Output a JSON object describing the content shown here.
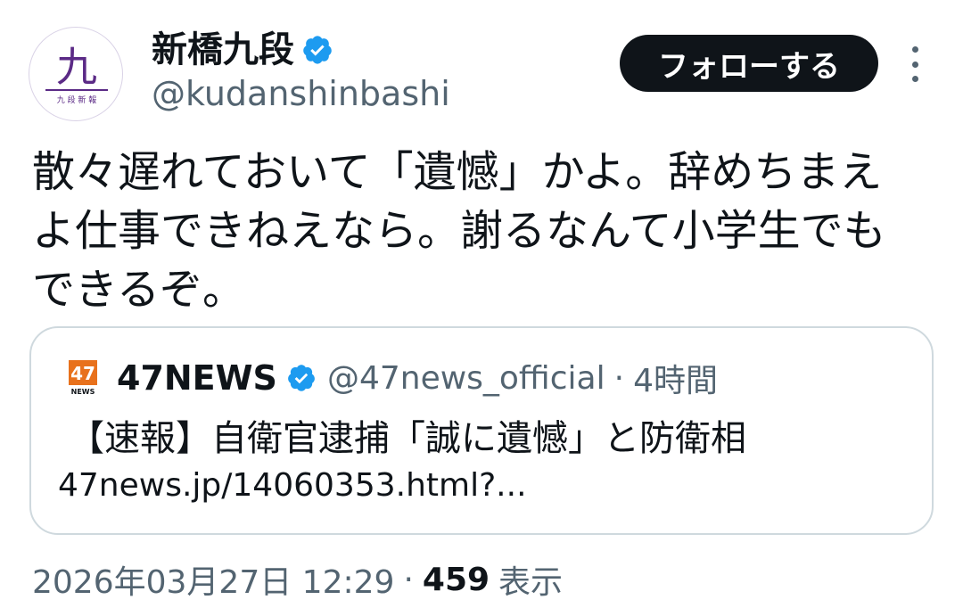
{
  "author": {
    "display_name": "新橋九段",
    "handle": "@kudanshinbashi",
    "avatar_glyph": "九",
    "avatar_caption": "九 段 新 報",
    "avatar_color": "#5b2a86",
    "verified_color": "#1d9bf0"
  },
  "actions": {
    "follow_label": "フォローする"
  },
  "tweet": {
    "lines": [
      "散々遅れておいて「遺憾」かよ。辞めちまえ",
      "よ仕事できねえなら。謝るなんて小学生でも",
      "できるぞ。"
    ]
  },
  "quote": {
    "logo_number": "47",
    "logo_caption": "NEWS",
    "logo_color": "#e8711c",
    "display_name": "47NEWS",
    "handle": "@47news_official",
    "separator": "·",
    "time": "4時間",
    "text": "【速報】自衛官逮捕「誠に遺憾」と防衛相",
    "link": "47news.jp/14060353.html?..."
  },
  "meta": {
    "timestamp": "2026年03月27日 12:29",
    "separator": "·",
    "views_count": "459",
    "views_label": "表示"
  }
}
